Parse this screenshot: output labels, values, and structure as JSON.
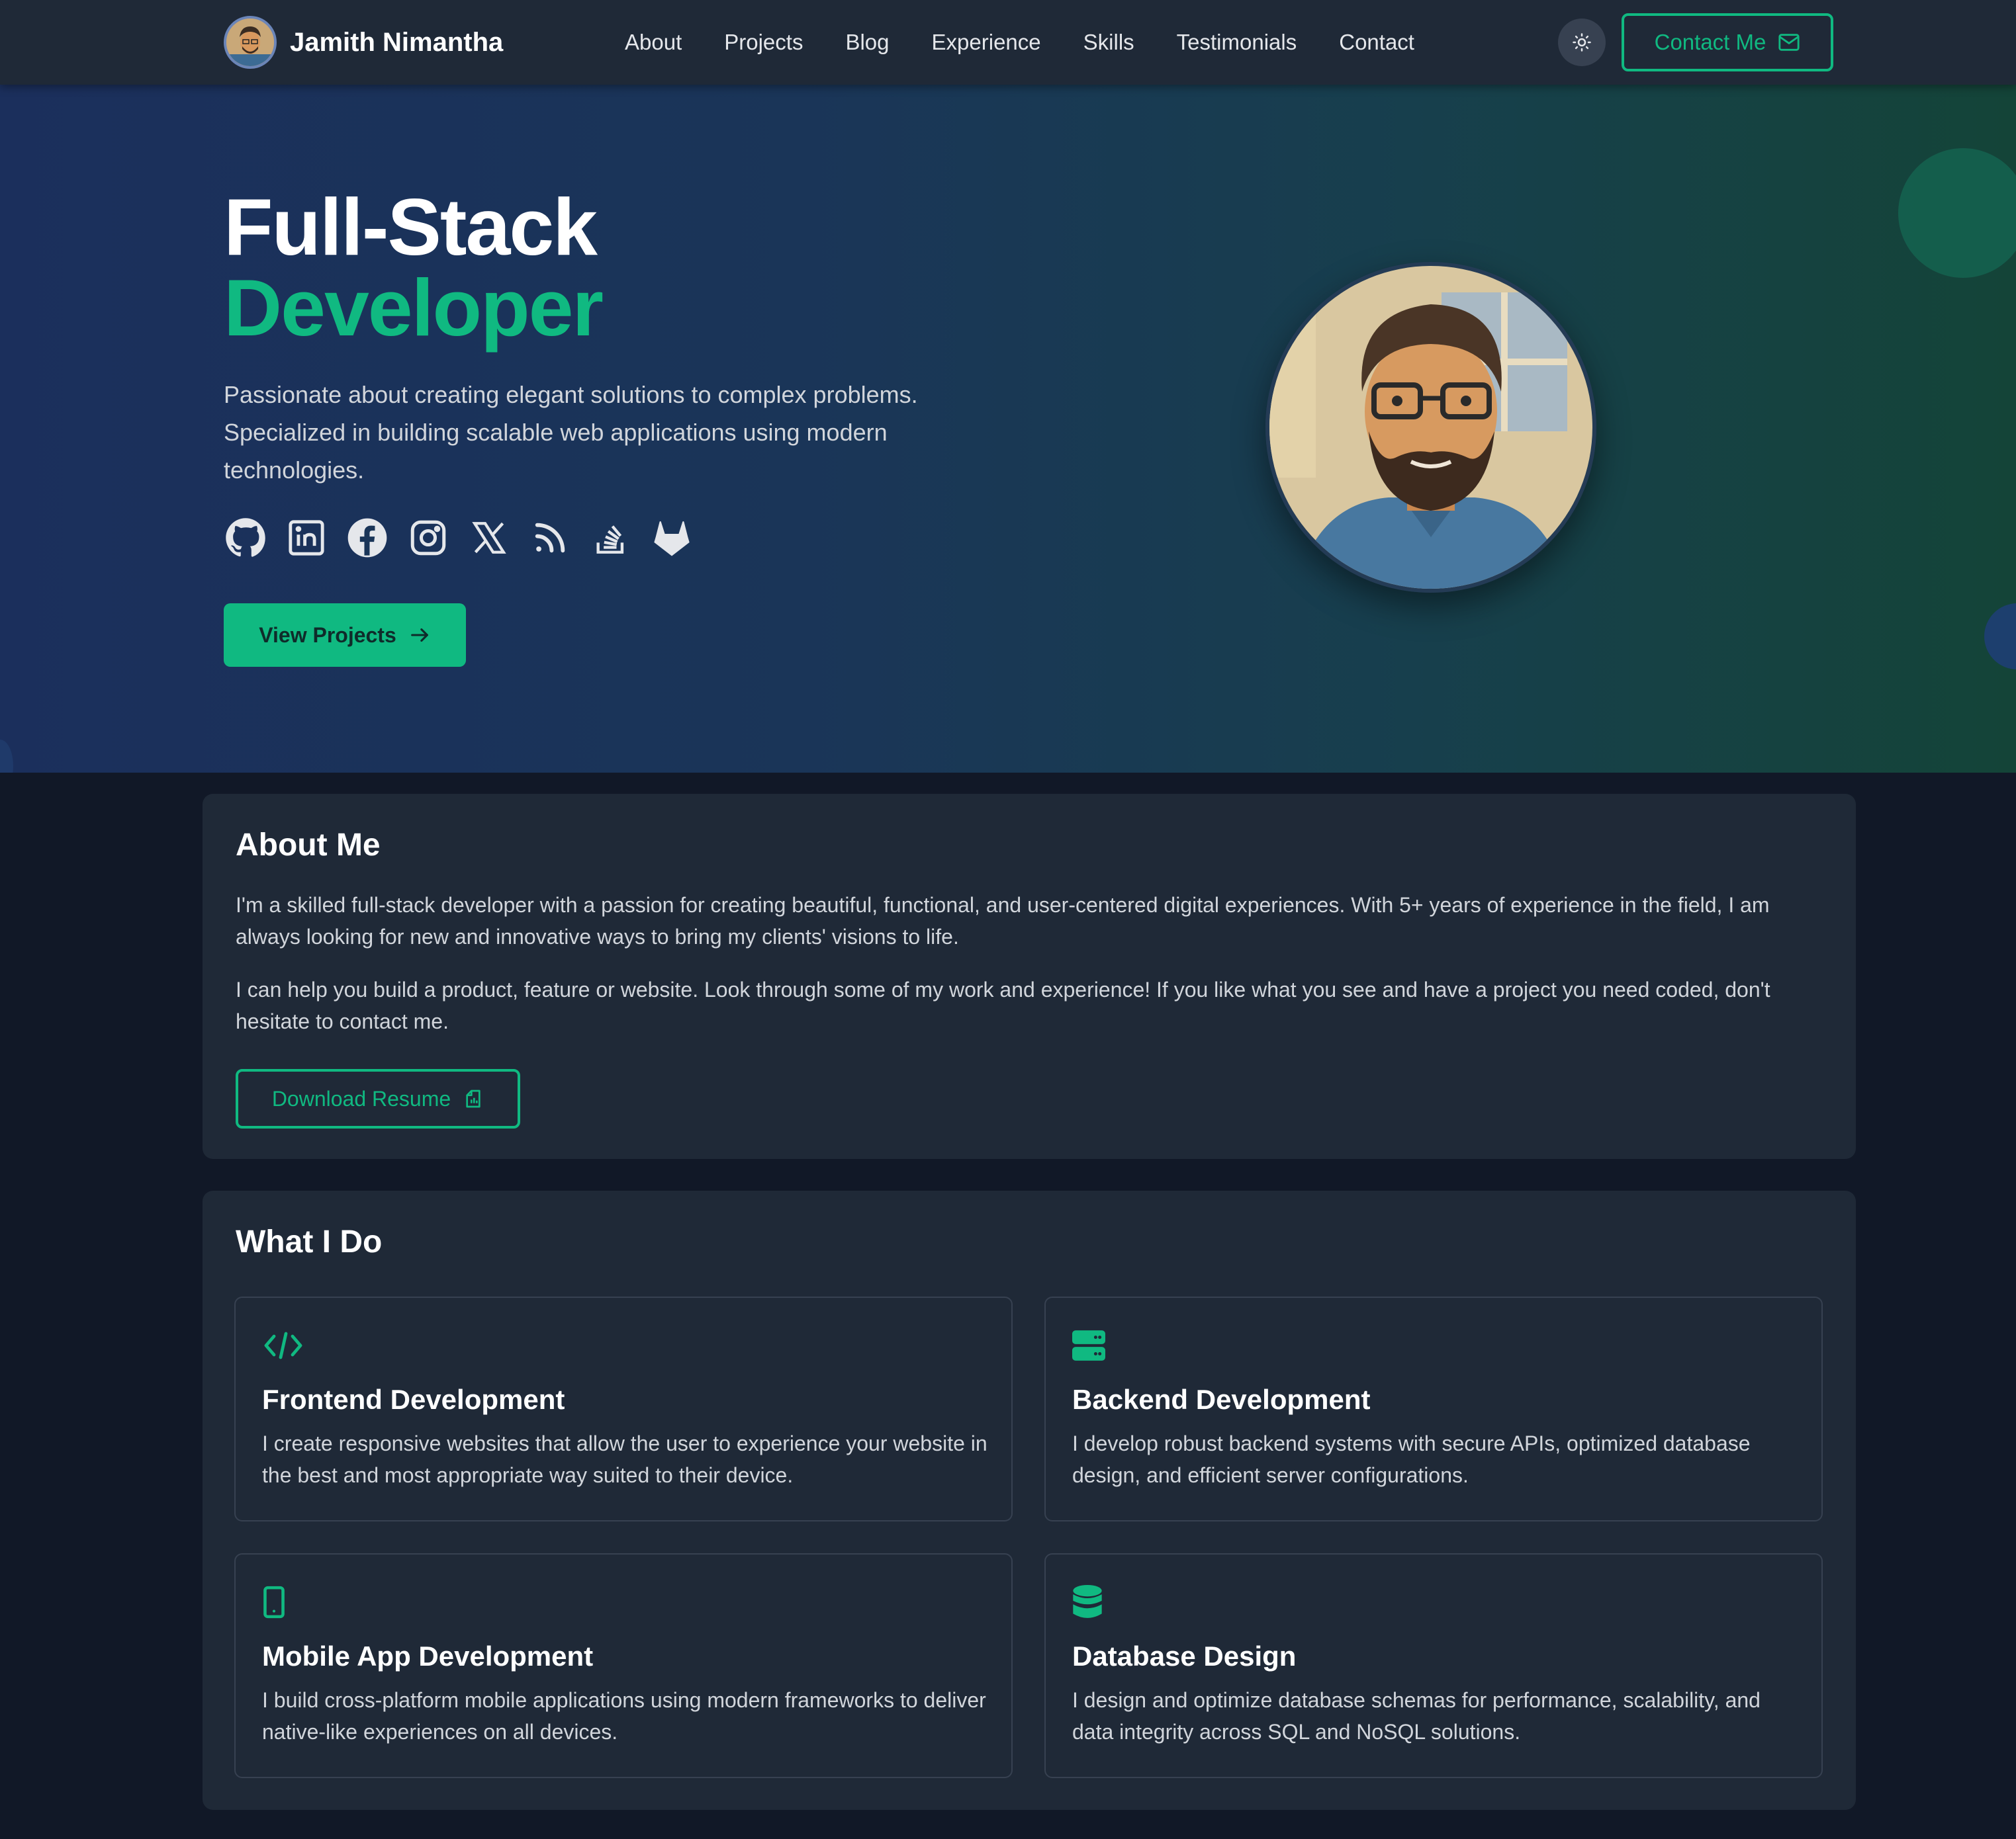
{
  "brand": {
    "name": "Jamith Nimantha",
    "avatar_icon": "avatar-icon"
  },
  "nav": {
    "links": [
      "About",
      "Projects",
      "Blog",
      "Experience",
      "Skills",
      "Testimonials",
      "Contact"
    ],
    "theme_icon": "sun-icon",
    "contact_label": "Contact Me"
  },
  "hero": {
    "title_line1": "Full-Stack",
    "title_line2": "Developer",
    "description": "Passionate about creating elegant solutions to complex problems. Specialized in building scalable web applications using modern technologies.",
    "socials": [
      "github-icon",
      "linkedin-icon",
      "facebook-icon",
      "instagram-icon",
      "x-icon",
      "rss-icon",
      "stackoverflow-icon",
      "gitlab-icon"
    ],
    "cta_label": "View Projects"
  },
  "about": {
    "title": "About Me",
    "p1": "I'm a skilled full-stack developer with a passion for creating beautiful, functional, and user-centered digital experiences. With 5+ years of experience in the field, I am always looking for new and innovative ways to bring my clients' visions to life.",
    "p2": "I can help you build a product, feature or website. Look through some of my work and experience! If you like what you see and have a project you need coded, don't hesitate to contact me.",
    "resume_label": "Download Resume"
  },
  "services": {
    "title": "What I Do",
    "items": [
      {
        "icon": "code-icon",
        "title": "Frontend Development",
        "desc": "I create responsive websites that allow the user to experience your website in the best and most appropriate way suited to their device."
      },
      {
        "icon": "server-icon",
        "title": "Backend Development",
        "desc": "I develop robust backend systems with secure APIs, optimized database design, and efficient server configurations."
      },
      {
        "icon": "mobile-icon",
        "title": "Mobile App Development",
        "desc": "I build cross-platform mobile applications using modern frameworks to deliver native-like experiences on all devices."
      },
      {
        "icon": "database-icon",
        "title": "Database Design",
        "desc": "I design and optimize database schemas for performance, scalability, and data integrity across SQL and NoSQL solutions."
      }
    ]
  },
  "colors": {
    "accent": "#10b981",
    "background": "#111827",
    "card": "#1f2937",
    "nav": "#1f2937"
  }
}
